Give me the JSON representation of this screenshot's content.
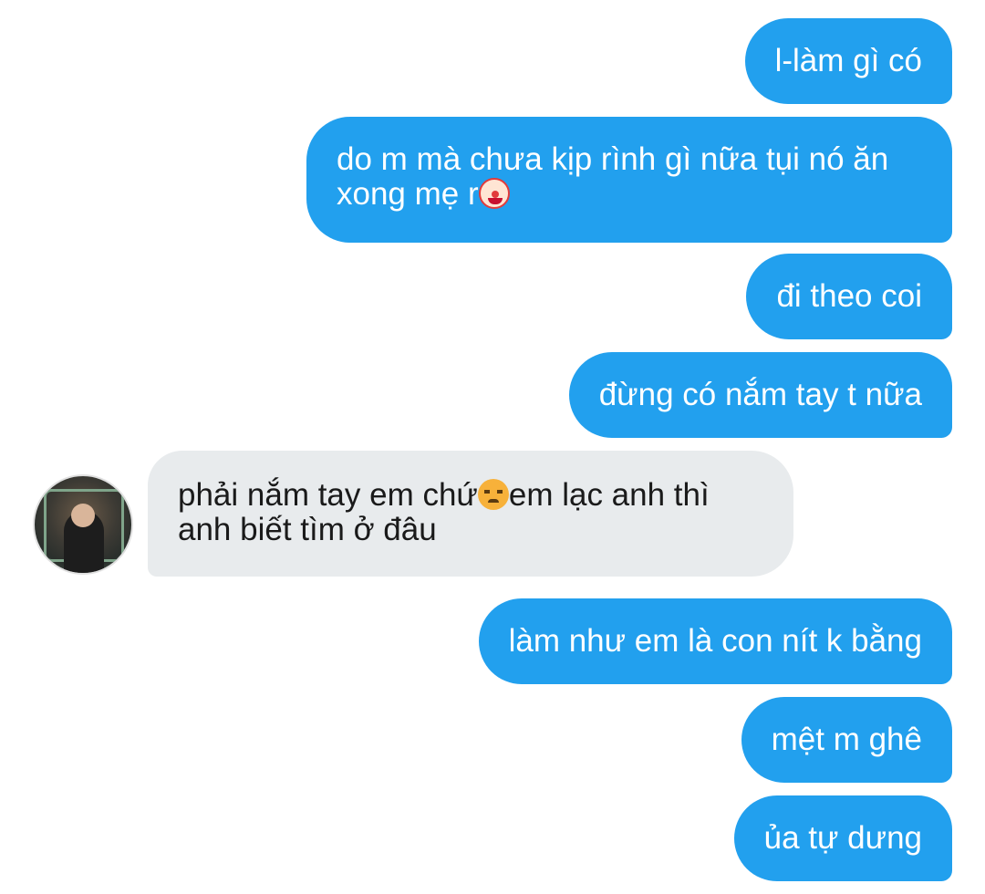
{
  "messages": [
    {
      "side": "sent",
      "text": "l-làm gì có"
    },
    {
      "side": "sent",
      "line1": "do m mà chưa kịp rình gì nữa tụi nó ăn",
      "line2": "xong mẹ r",
      "emoji": "clown-face-icon"
    },
    {
      "side": "sent",
      "text": "đi theo coi"
    },
    {
      "side": "sent",
      "text": "đừng có nắm tay t nữa"
    },
    {
      "side": "received",
      "line1_a": "phải nắm tay em chứ",
      "line1_b": "em lạc anh thì",
      "line2": "anh biết tìm ở đâu",
      "emoji": "angry-face-icon"
    },
    {
      "side": "sent",
      "text": "làm như em là con nít k bằng"
    },
    {
      "side": "sent",
      "text": "mệt m ghê"
    },
    {
      "side": "sent",
      "text": "ủa tự dưng"
    }
  ],
  "colors": {
    "sent_bubble": "#22a0ee",
    "sent_text": "#ffffff",
    "received_bubble": "#e8ebed",
    "received_text": "#1a1a1a",
    "background": "#ffffff"
  }
}
